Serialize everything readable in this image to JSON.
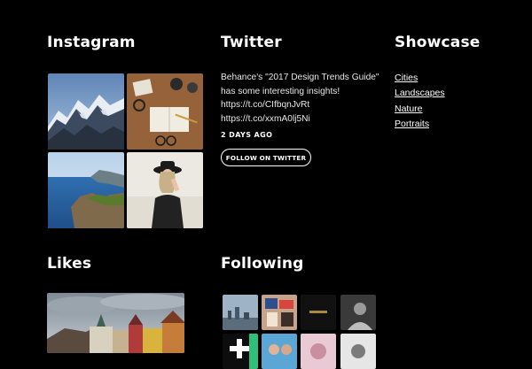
{
  "instagram": {
    "title": "Instagram"
  },
  "twitter": {
    "title": "Twitter",
    "tweet_lines": [
      "Behance's \"2017 Design Trends Guide\"",
      "has some interesting insights!",
      "https://t.co/CIfbqnJvRt",
      "https://t.co/xxmA0lj5Ni"
    ],
    "time": "2 DAYS AGO",
    "follow_label": "FOLLOW ON TWITTER"
  },
  "showcase": {
    "title": "Showcase",
    "links": [
      "Cities",
      "Landscapes",
      "Nature",
      "Portraits"
    ]
  },
  "likes": {
    "title": "Likes"
  },
  "following": {
    "title": "Following"
  }
}
